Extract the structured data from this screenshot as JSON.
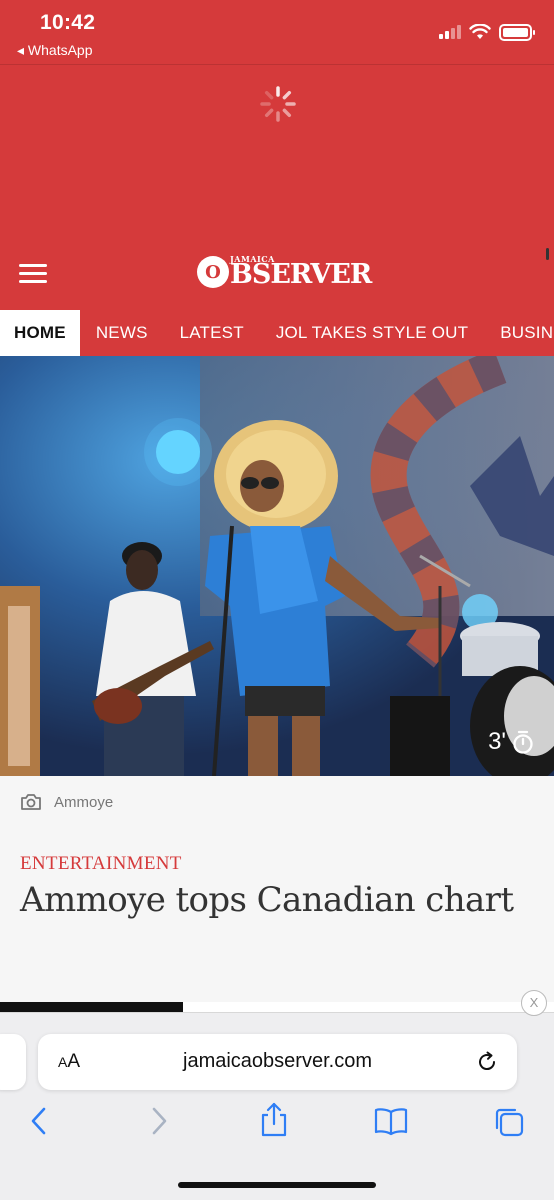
{
  "status_bar": {
    "time": "10:42",
    "back_label": "◂ WhatsApp"
  },
  "site": {
    "logo_small": "JAMAICA",
    "logo_mark": "O",
    "logo_text": "BSERVER",
    "brand_color": "#d53a3b"
  },
  "nav": {
    "items": [
      {
        "label": "HOME",
        "active": true
      },
      {
        "label": "NEWS"
      },
      {
        "label": "LATEST"
      },
      {
        "label": "JOL TAKES STYLE OUT"
      },
      {
        "label": "BUSINE"
      }
    ]
  },
  "hero": {
    "duration": "3'",
    "duration_icon": "stopwatch-icon",
    "camera_icon": "camera-icon"
  },
  "article": {
    "caption": "Ammoye",
    "category": "ENTERTAINMENT",
    "headline": "Ammoye tops Canadian chart"
  },
  "ad": {
    "close_label": "X"
  },
  "browser": {
    "text_size_small": "A",
    "text_size_large": "A",
    "url": "jamaicaobserver.com",
    "icons": [
      "back-icon",
      "forward-icon",
      "share-icon",
      "bookmarks-icon",
      "tabs-icon",
      "reload-icon"
    ]
  }
}
